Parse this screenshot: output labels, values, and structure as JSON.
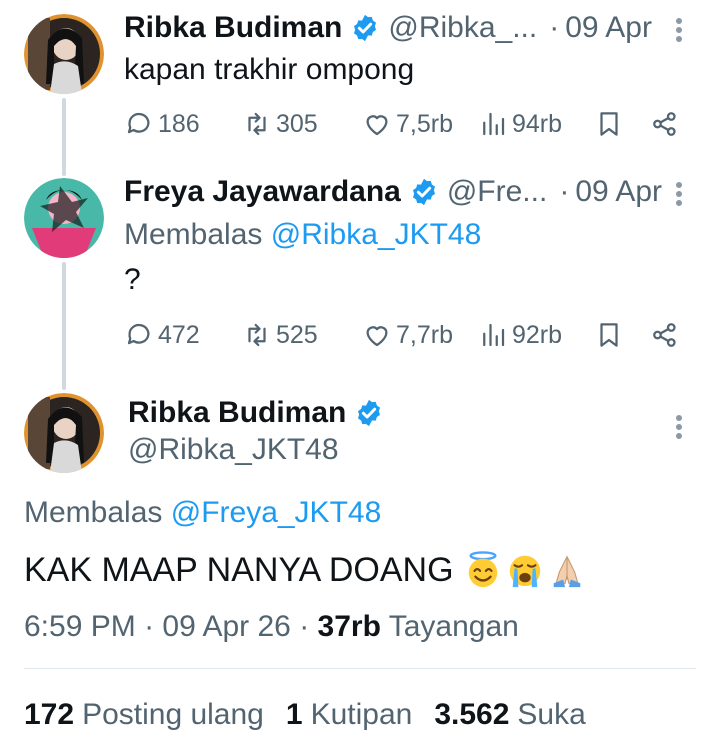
{
  "tweets": [
    {
      "name": "Ribka Budiman",
      "handle": "@Ribka_...",
      "dot": "·",
      "date": "09 Apr",
      "text": "kapan trakhir ompong",
      "replies": "186",
      "retweets": "305",
      "likes": "7,5rb",
      "views": "94rb"
    },
    {
      "name": "Freya Jayawardana",
      "handle": "@Fre...",
      "dot": "·",
      "date": "09 Apr",
      "reply_prefix": "Membalas",
      "reply_mention": "@Ribka_JKT48",
      "text": "?",
      "replies": "472",
      "retweets": "525",
      "likes": "7,7rb",
      "views": "92rb"
    }
  ],
  "main_tweet": {
    "name": "Ribka Budiman",
    "handle": "@Ribka_JKT48",
    "reply_prefix": "Membalas",
    "reply_mention": "@Freya_JKT48",
    "text": "KAK MAAP NANYA DOANG",
    "emojis": [
      "smiling-face-with-halo",
      "loudly-crying-face",
      "folded-hands"
    ],
    "time": "6:59 PM",
    "sep": "·",
    "date": "09 Apr 26",
    "sep2": "·",
    "views_count": "37rb",
    "views_label": "Tayangan",
    "stats": {
      "reposts_count": "172",
      "reposts_label": "Posting ulang",
      "quotes_count": "1",
      "quotes_label": "Kutipan",
      "likes_count": "3.562",
      "likes_label": "Suka"
    }
  },
  "colors": {
    "text": "#0f1419",
    "muted": "#536471",
    "link": "#1d9bf0",
    "verified": "#1d9bf0"
  }
}
